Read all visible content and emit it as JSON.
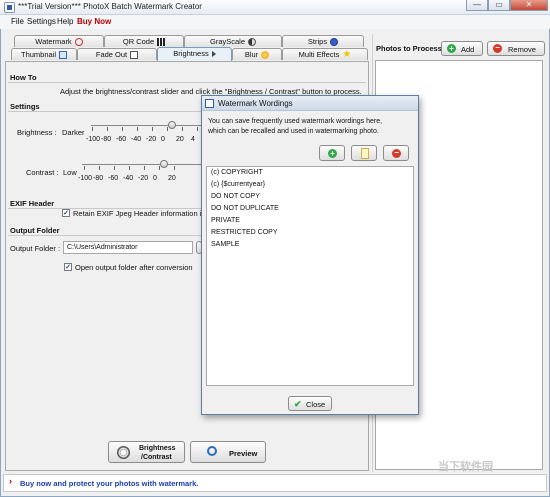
{
  "window": {
    "title": "***Trial Version*** PhotoX Batch Watermark Creator",
    "min_label": "—",
    "max_label": "▭",
    "close_label": "✕"
  },
  "menu": {
    "file": "File",
    "settings": "Settings",
    "help": "Help",
    "buy": "Buy Now"
  },
  "tabs_row1": [
    "Watermark",
    "QR Code",
    "GrayScale",
    "Strips"
  ],
  "tabs_row2": [
    "Thumbnail",
    "Fade Out",
    "Brightness",
    "Blur",
    "Multi Effects"
  ],
  "howto": {
    "heading": "How To",
    "text": "Adjust the brightness/contrast slider and click the \"Brightness / Contrast\" button to process."
  },
  "settings": {
    "heading": "Settings",
    "brightness": {
      "label": "Brightness :",
      "low": "Darker",
      "ticks": [
        "-100",
        "-80",
        "-60",
        "-40",
        "-20",
        "0",
        "20",
        "4"
      ],
      "value": 0
    },
    "contrast": {
      "label": "Contrast :",
      "low": "Low",
      "ticks": [
        "-100",
        "-80",
        "-60",
        "-40",
        "-20",
        "0",
        "20"
      ],
      "value": 0
    }
  },
  "exif": {
    "heading": "EXIF Header",
    "retain_label": "Retain EXIF Jpeg Header information in th",
    "retain_checked": true
  },
  "output": {
    "heading": "Output Folder",
    "label": "Output Folder :",
    "path": "C:\\Users\\Administrator",
    "open_label": "Open output folder after conversion",
    "open_checked": true
  },
  "actions": {
    "brightness_line1": "Brightness",
    "brightness_line2": "/Contrast",
    "preview": "Preview"
  },
  "photos": {
    "title": "Photos to Process",
    "add": "Add",
    "remove": "Remove"
  },
  "status": {
    "text": "Buy now and protect your photos with watermark."
  },
  "dialog": {
    "title": "Watermark Wordings",
    "description_line1": "You can save frequently used watermark wordings here,",
    "description_line2": "which can be recalled and used in watermarking photo.",
    "items": [
      "(c) COPYRIGHT",
      "(c) {$currentyear}",
      "DO NOT COPY",
      "DO NOT DUPLICATE",
      "PRIVATE",
      "RESTRICTED COPY",
      "SAMPLE"
    ],
    "close": "Close"
  },
  "watermark_logo": "当下软件园"
}
